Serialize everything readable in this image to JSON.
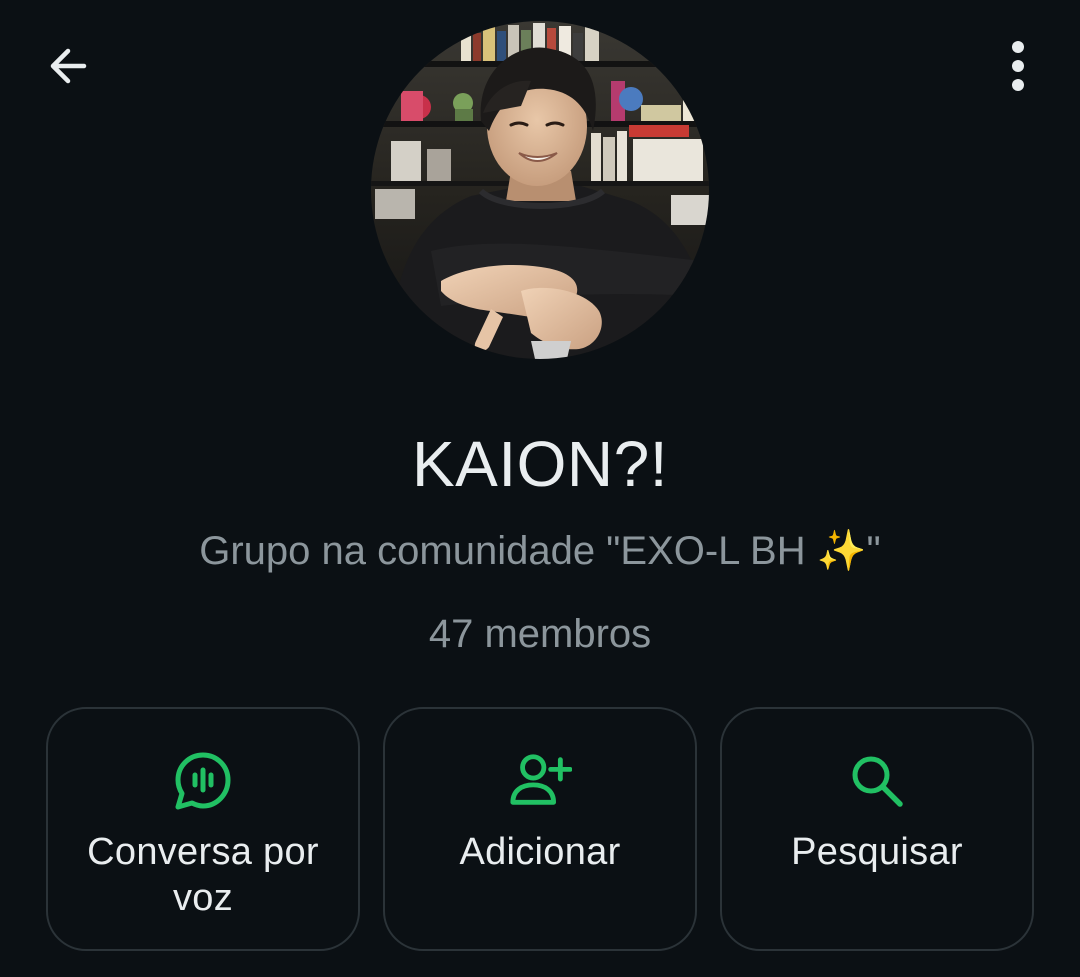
{
  "header": {
    "back_icon": "arrow-left-icon",
    "menu_icon": "more-vertical-icon"
  },
  "group": {
    "name": "KAION?!",
    "subtitle_prefix": "Grupo na comunidade \"EXO-L BH ",
    "subtitle_emoji": "✨",
    "subtitle_suffix": "\"",
    "members": "47 membros",
    "avatar": "group-photo"
  },
  "actions": [
    {
      "label": "Conversa por voz",
      "icon": "voice-chat-icon"
    },
    {
      "label": "Adicionar",
      "icon": "add-person-icon"
    },
    {
      "label": "Pesquisar",
      "icon": "search-icon"
    }
  ],
  "colors": {
    "background": "#0b1014",
    "accent": "#21c063",
    "text_primary": "#e9edef",
    "text_secondary": "#8c969c",
    "card_border": "#2b3338"
  }
}
